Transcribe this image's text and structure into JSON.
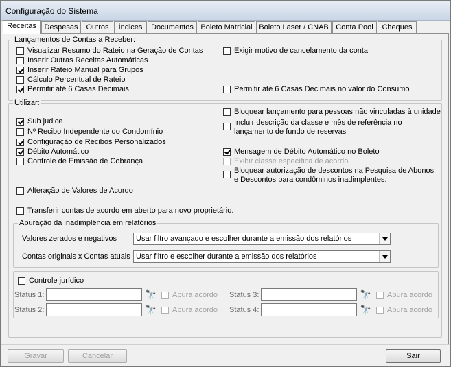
{
  "window": {
    "title": "Configuração do Sistema"
  },
  "tabs": [
    "Receitas",
    "Despesas",
    "Outros",
    "Índices",
    "Documentos",
    "Boleto Matricial",
    "Boleto Laser / CNAB",
    "Conta Pool",
    "Cheques"
  ],
  "lanc": {
    "label": "Lançamentos de Contas a Receber:",
    "items": [
      {
        "label": "Visualizar Resumo do Rateio na Geração de Contas",
        "checked": false
      },
      {
        "label": "Inserir Outras Receitas Automáticas",
        "checked": false
      },
      {
        "label": "Inserir Rateio Manual para Grupos",
        "checked": true
      },
      {
        "label": "Cálculo Percentual de Rateio",
        "checked": false
      },
      {
        "label": "Permitir até 6 Casas Decimais",
        "checked": true
      },
      {
        "label": "Exigir motivo de cancelamento da conta",
        "checked": false
      },
      {
        "label": "Permitir até 6 Casas Decimais no valor do Consumo",
        "checked": false
      }
    ]
  },
  "utilizar": {
    "label": "Utilizar:",
    "items": [
      {
        "label": "Sub judice",
        "checked": true
      },
      {
        "label": "Nº Recibo Independente do Condomínio",
        "checked": false
      },
      {
        "label": "Configuração de Recibos Personalizados",
        "checked": true
      },
      {
        "label": "Débito Automático",
        "checked": true
      },
      {
        "label": "Controle de Emissão de Cobrança",
        "checked": false
      },
      {
        "label": "Alteração de Valores de Acordo",
        "checked": false
      },
      {
        "label": "Transferir contas de acordo em aberto para novo proprietário.",
        "checked": false
      },
      {
        "label": "Bloquear lançamento para pessoas não vinculadas à unidade",
        "checked": false
      },
      {
        "label": "Incluir descrição da classe e mês de referência no lançamento de fundo de reservas",
        "checked": false
      },
      {
        "label": "Mensagem de Débito Automático no Boleto",
        "checked": true
      },
      {
        "label": "Exibir classe específica de acordo",
        "checked": false
      },
      {
        "label": "Bloquear autorização de descontos na Pesquisa de Abonos e Descontos para condôminos inadimplentes.",
        "checked": false
      }
    ]
  },
  "apuracao": {
    "label": "Apuração da inadimplência em relatórios",
    "zerados_label": "Valores zerados e negativos",
    "zerados_value": "Usar filtro avançado e escolher durante a emissão dos relatórios",
    "originais_label": "Contas originais x Contas atuais",
    "originais_value": "Usar filtro e escolher durante a emissão dos relatórios"
  },
  "juridico": {
    "label": "Controle jurídico",
    "status1": "Status 1:",
    "status2": "Status 2:",
    "status3": "Status 3:",
    "status4": "Status 4:",
    "apura": "Apura acordo"
  },
  "buttons": {
    "gravar": "Gravar",
    "cancelar": "Cancelar",
    "sair": "Sair"
  }
}
